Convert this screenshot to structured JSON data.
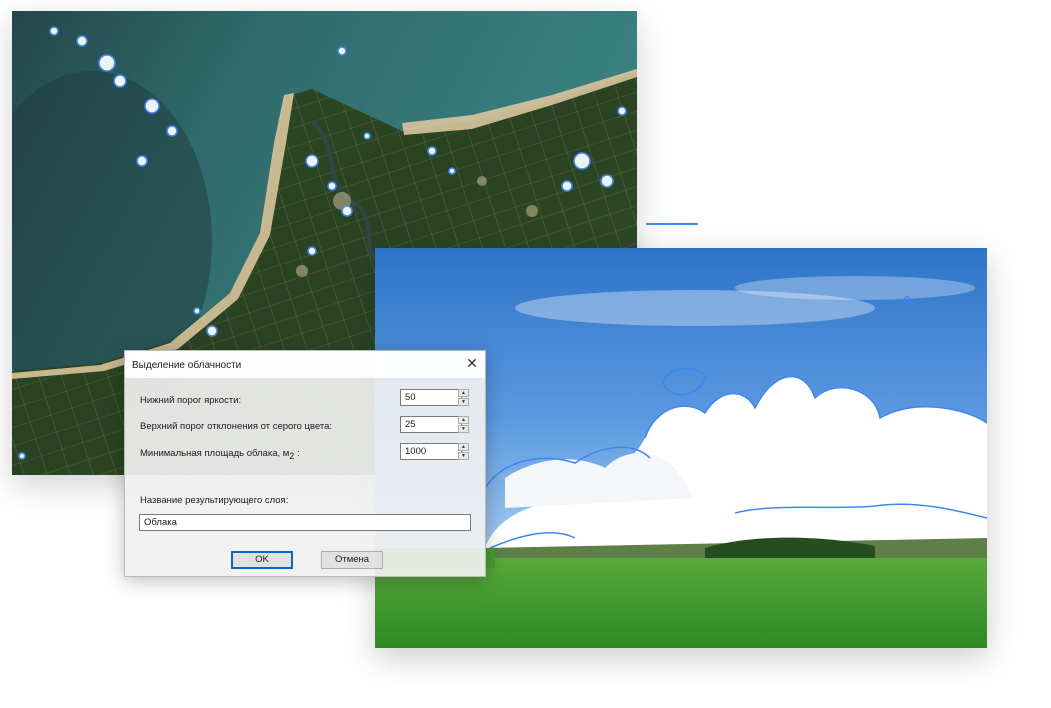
{
  "dialog": {
    "title": "Выделение облачности",
    "close_glyph": "✕",
    "brightness_label": "Нижний порог яркости:",
    "brightness_value": "50",
    "gray_label": "Верхний порог отклонения от серого цвета:",
    "gray_value": "25",
    "area_label": "Минимальная площадь облака, м",
    "area_sub": "2",
    "area_suffix": " :",
    "area_value": "1000",
    "layer_label": "Название результирующего слоя:",
    "layer_value": "Облака",
    "ok_label": "OK",
    "cancel_label": "Отмена",
    "spin_up": "▲",
    "spin_down": "▼"
  },
  "colors": {
    "accent": "#3d8bf0",
    "cloud_outline": "#3f86f5",
    "sea": "#2f6f70",
    "land": "#2f4a27",
    "sky": "#4c8fd8",
    "grass": "#3f9a2c"
  },
  "icons": [
    "close-icon",
    "spin-up-icon",
    "spin-down-icon"
  ]
}
